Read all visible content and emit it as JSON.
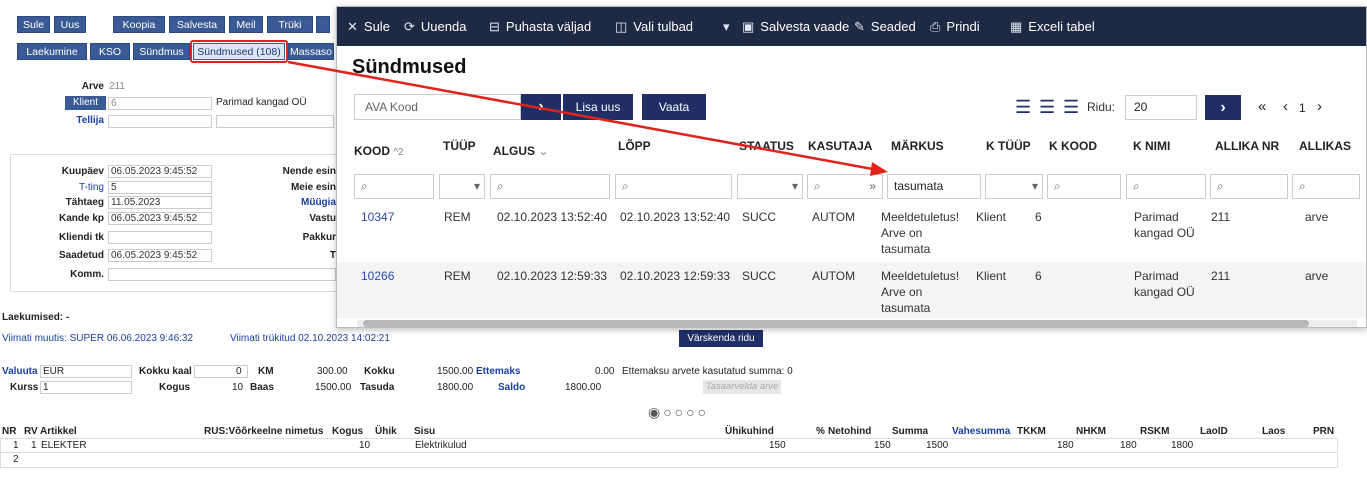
{
  "toolbar": {
    "buttons": [
      "Sule",
      "Uus",
      "Koopia",
      "Salvesta",
      "Meil",
      "Trüki"
    ]
  },
  "tabs": [
    "Laekumine",
    "KSO",
    "Sündmus",
    "Sündmused (108)",
    "Massaso"
  ],
  "header": {
    "arve_label": "Arve",
    "arve_value": "211",
    "klient_label": "Klient",
    "klient_value": "6",
    "klient_name": "Parimad kangad OÜ",
    "tellija_label": "Tellija"
  },
  "dates": {
    "kuupaev_label": "Kuupäev",
    "kuupaev_value": "06.05.2023 9:45:52",
    "tting_label": "T-ting",
    "tting_value": "5",
    "tahtaeg_label": "Tähtaeg",
    "tahtaeg_value": "11.05.2023",
    "kandekp_label": "Kande kp",
    "kandekp_value": "06.05.2023 9:45:52",
    "kliendi_label": "Kliendi tk",
    "saadetud_label": "Saadetud",
    "saadetud_value": "06.05.2023 9:45:52",
    "komm_label": "Komm.",
    "nende_label": "Nende esin",
    "meie_label": "Meie esin",
    "myygi_label": "Müügia",
    "vastu_label": "Vastu",
    "pakku_label": "Pakkur",
    "t_label": "T"
  },
  "status": {
    "laekumised": "Laekumised: -",
    "viimati_muutis": "Viimati muutis: SUPER 06.06.2023 9:46:32",
    "viimati_trykitud": "Viimati trükitud 02.10.2023 14:02:21",
    "varskenda": "Värskenda ridu"
  },
  "totals": {
    "valuuta_label": "Valuuta",
    "valuuta": "EUR",
    "kokku_kaal_label": "Kokku kaal",
    "kokku_kaal": "0",
    "km_label": "KM",
    "km": "300.00",
    "kokku_label": "Kokku",
    "kokku": "1500.00",
    "ettemaks_label": "Ettemaks",
    "ettemaks": "0.00",
    "ettemaks_note": "Ettemaksu arvete kasutatud summa: 0",
    "kurss_label": "Kurss",
    "kurss": "1",
    "kogus_label": "Kogus",
    "kogus": "10",
    "baas_label": "Baas",
    "baas": "1500.00",
    "tasuda_label": "Tasuda",
    "tasuda": "1800.00",
    "saldo_label": "Saldo",
    "saldo": "1800.00",
    "tasaarvelda": "Tasaarvelda arve"
  },
  "rows_table": {
    "headers": [
      "NR",
      "RV",
      "Artikkel",
      "RUS:Võõrkeelne nimetus",
      "Kogus",
      "Ühik",
      "Sisu",
      "Ühikuhind",
      "%",
      "Netohind",
      "Summa",
      "Vahesumma",
      "TKKM",
      "NHKM",
      "RSKM",
      "LaoID",
      "Laos",
      "PRN"
    ],
    "row1": {
      "nr": "1",
      "rv": "1",
      "artikkel": "ELEKTER",
      "kogus": "10",
      "sisu": "Elektrikulud",
      "uhikuhind": "150",
      "netohind": "150",
      "summa": "1500",
      "tkkm": "180",
      "nhkm": "180",
      "rskm": "1800"
    },
    "row2": {
      "nr": "2"
    }
  },
  "overlay": {
    "toolbar": [
      "Sule",
      "Uuenda",
      "Puhasta väljad",
      "Vali tulbad",
      "Salvesta vaade",
      "Seaded",
      "Prindi",
      "Exceli tabel"
    ],
    "title": "Sündmused",
    "search_placeholder": "AVA Kood",
    "lisa_uus": "Lisa uus",
    "vaata": "Vaata",
    "ridu_label": "Ridu:",
    "ridu_value": "20",
    "page": "1",
    "columns": [
      "KOOD",
      "TÜÜP",
      "ALGUS",
      "LÕPP",
      "STAATUS",
      "KASUTAJA",
      "MÄRKUS",
      "K TÜÜP",
      "K KOOD",
      "K NIMI",
      "ALLIKA NR",
      "ALLIKAS"
    ],
    "kood_sort": "^2",
    "markus_filter": "tasumata",
    "rows": [
      {
        "kood": "10347",
        "tyyp": "REM",
        "algus": "02.10.2023 13:52:40",
        "lopp": "02.10.2023 13:52:40",
        "staatus": "SUCC",
        "kasutaja": "AUTOM",
        "markus1": "Meeldetuletus!",
        "markus2": "Arve on",
        "markus3": "tasumata",
        "ktyyp": "Klient",
        "kkood": "6",
        "knimi1": "Parimad",
        "knimi2": "kangad OÜ",
        "allikanr": "211",
        "allikas": "arve"
      },
      {
        "kood": "10266",
        "tyyp": "REM",
        "algus": "02.10.2023 12:59:33",
        "lopp": "02.10.2023 12:59:33",
        "staatus": "SUCC",
        "kasutaja": "AUTOM",
        "markus1": "Meeldetuletus!",
        "markus2": "Arve on",
        "markus3": "tasumata",
        "ktyyp": "Klient",
        "kkood": "6",
        "knimi1": "Parimad",
        "knimi2": "kangad OÜ",
        "allikanr": "211",
        "allikas": "arve"
      }
    ]
  },
  "colors": {
    "navy": "#1e2a43",
    "button_blue": "#3a5a95",
    "highlight_red": "#e0241c"
  },
  "icons": [
    "close-icon",
    "refresh-icon",
    "clear-icon",
    "columns-icon",
    "save-icon",
    "wrench-icon",
    "print-icon",
    "excel-icon",
    "search-icon",
    "list-view-icon"
  ]
}
